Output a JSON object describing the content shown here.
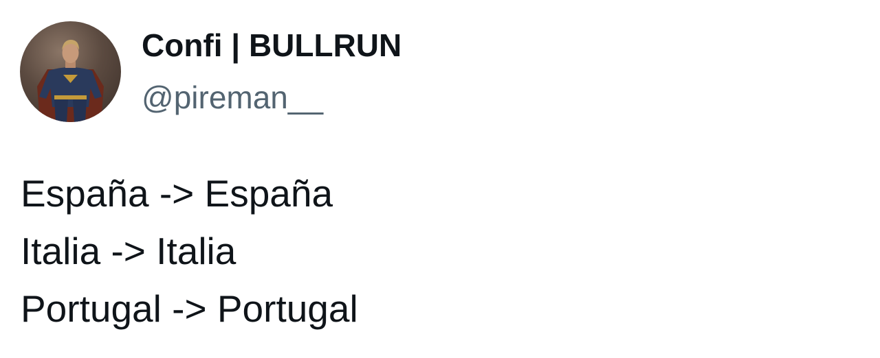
{
  "author": {
    "display_name": "Confi | BULLRUN",
    "handle": "@pireman__",
    "avatar_icon": "profile-avatar"
  },
  "tweet": {
    "lines": [
      "España -> España",
      "Italia -> Italia",
      "Portugal -> Portugal"
    ]
  },
  "colors": {
    "text": "#0f1419",
    "handle": "#536471",
    "background": "#ffffff"
  }
}
